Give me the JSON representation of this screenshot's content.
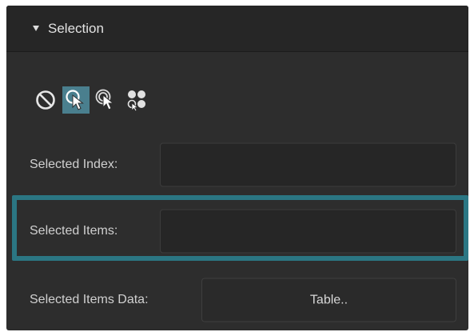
{
  "section": {
    "title": "Selection"
  },
  "selection_modes": [
    {
      "name": "none",
      "icon": "no-selection-icon",
      "active": false
    },
    {
      "name": "single",
      "icon": "single-select-cursor-icon",
      "active": true
    },
    {
      "name": "multiple",
      "icon": "multi-select-cursor-icon",
      "active": false
    },
    {
      "name": "group",
      "icon": "group-select-icon",
      "active": false
    }
  ],
  "fields": {
    "selected_index": {
      "label": "Selected Index:",
      "value": ""
    },
    "selected_items": {
      "label": "Selected Items:",
      "value": ""
    },
    "selected_items_data": {
      "label": "Selected Items Data:",
      "button_label": "Table.."
    }
  },
  "colors": {
    "panel_bg": "#2d2d2d",
    "header_bg": "#262626",
    "active_mode_bg": "#4a7f8e",
    "highlight_border": "#2b7683"
  }
}
